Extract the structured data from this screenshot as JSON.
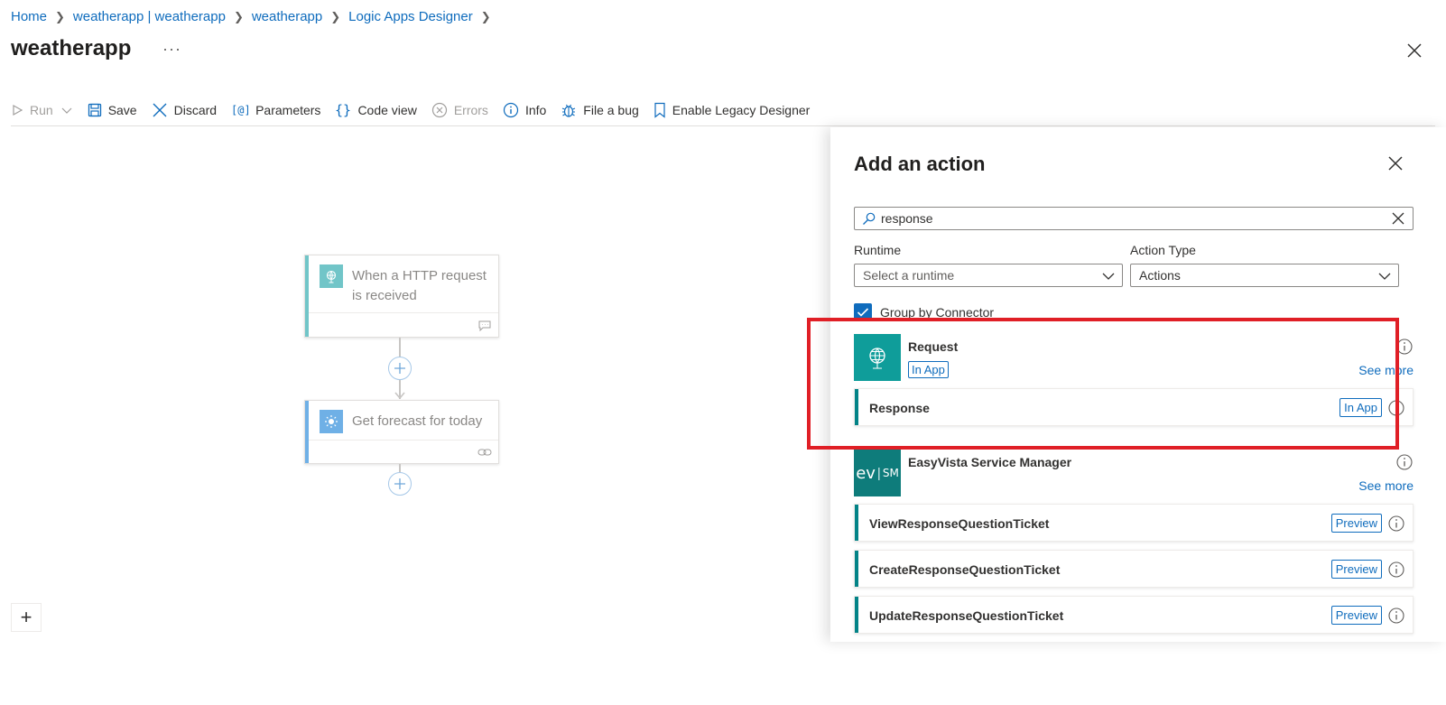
{
  "breadcrumb": {
    "items": [
      "Home",
      "weatherapp | weatherapp",
      "weatherapp",
      "Logic Apps Designer"
    ]
  },
  "page": {
    "title": "weatherapp",
    "more": "···"
  },
  "toolbar": {
    "run": "Run",
    "save": "Save",
    "discard": "Discard",
    "parameters": "Parameters",
    "code_view": "Code view",
    "errors": "Errors",
    "info": "Info",
    "file_bug": "File a bug",
    "legacy": "Enable Legacy Designer"
  },
  "canvas": {
    "trigger": {
      "label": "When a HTTP request is received",
      "color": "#71c5c8"
    },
    "action": {
      "label": "Get forecast for today",
      "color": "#6fb0e6"
    },
    "add_plus": "+"
  },
  "panel": {
    "title": "Add an action",
    "search": {
      "value": "response"
    },
    "runtime": {
      "label": "Runtime",
      "value": "Select a runtime"
    },
    "action_type": {
      "label": "Action Type",
      "value": "Actions"
    },
    "group_by": "Group by Connector",
    "connectors": [
      {
        "name": "Request",
        "badge": "In App",
        "see_more": "See more",
        "logo_color": "#0f9d9a",
        "actions": [
          {
            "name": "Response",
            "badge": "In App"
          }
        ]
      },
      {
        "name": "EasyVista Service Manager",
        "see_more": "See more",
        "logo_text_a": "ev",
        "logo_text_b": "SM",
        "logo_color": "#0e7c7b",
        "actions": [
          {
            "name": "ViewResponseQuestionTicket",
            "badge": "Preview"
          },
          {
            "name": "CreateResponseQuestionTicket",
            "badge": "Preview"
          },
          {
            "name": "UpdateResponseQuestionTicket",
            "badge": "Preview"
          }
        ]
      }
    ]
  },
  "colors": {
    "accent": "#0f6cbd",
    "highlight": "#e01f26",
    "teal": "#038387"
  }
}
